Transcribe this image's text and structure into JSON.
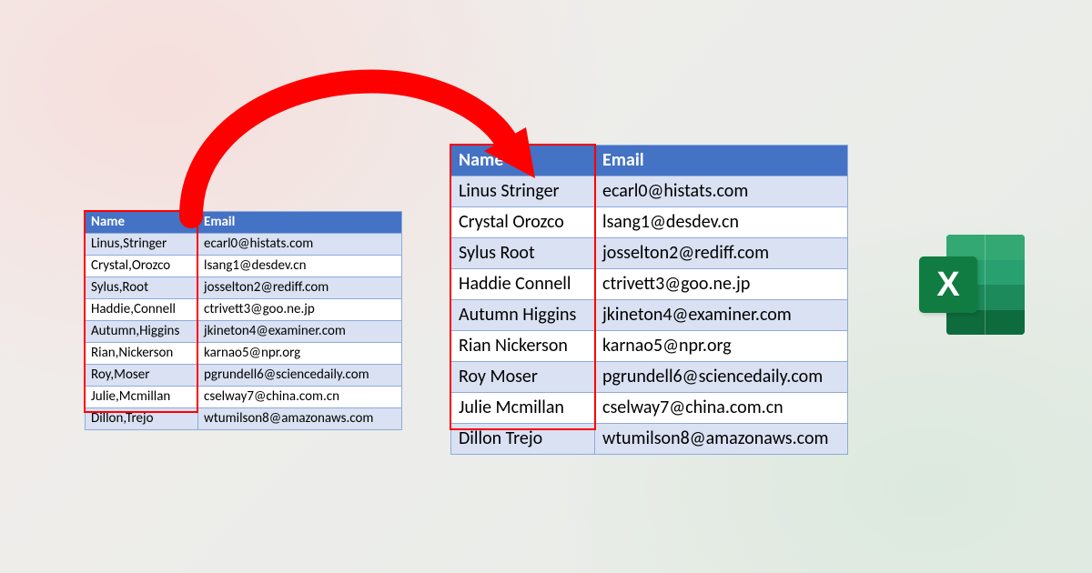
{
  "left_table": {
    "headers": [
      "Name",
      "Email"
    ],
    "rows": [
      [
        "Linus,Stringer",
        "ecarl0@histats.com"
      ],
      [
        "Crystal,Orozco",
        "lsang1@desdev.cn"
      ],
      [
        "Sylus,Root",
        "josselton2@rediff.com"
      ],
      [
        "Haddie,Connell",
        "ctrivett3@goo.ne.jp"
      ],
      [
        "Autumn,Higgins",
        "jkineton4@examiner.com"
      ],
      [
        "Rian,Nickerson",
        "karnao5@npr.org"
      ],
      [
        "Roy,Moser",
        "pgrundell6@sciencedaily.com"
      ],
      [
        "Julie,Mcmillan",
        "cselway7@china.com.cn"
      ],
      [
        "Dillon,Trejo",
        "wtumilson8@amazonaws.com"
      ]
    ]
  },
  "right_table": {
    "headers": [
      "Name",
      "Email"
    ],
    "rows": [
      [
        "Linus Stringer",
        "ecarl0@histats.com"
      ],
      [
        "Crystal Orozco",
        "lsang1@desdev.cn"
      ],
      [
        "Sylus Root",
        "josselton2@rediff.com"
      ],
      [
        "Haddie Connell",
        "ctrivett3@goo.ne.jp"
      ],
      [
        "Autumn Higgins",
        "jkineton4@examiner.com"
      ],
      [
        "Rian Nickerson",
        "karnao5@npr.org"
      ],
      [
        "Roy Moser",
        "pgrundell6@sciencedaily.com"
      ],
      [
        "Julie Mcmillan",
        "cselway7@china.com.cn"
      ],
      [
        "Dillon Trejo",
        "wtumilson8@amazonaws.com"
      ]
    ]
  },
  "excel_badge": {
    "letter": "X"
  },
  "colors": {
    "header_bg": "#4472c4",
    "band_bg": "#d9e1f2",
    "arrow": "#ff0000",
    "highlight": "#ff0000"
  }
}
